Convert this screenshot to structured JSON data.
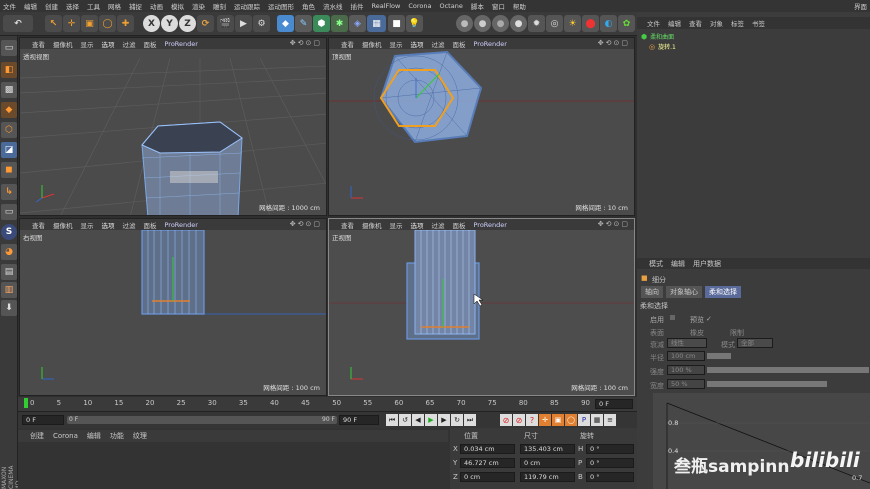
{
  "menubar": {
    "items": [
      "文件",
      "编辑",
      "创建",
      "选择",
      "工具",
      "网格",
      "捕捉",
      "动画",
      "模拟",
      "渲染",
      "雕刻",
      "运动跟踪",
      "运动图形",
      "角色",
      "流水线",
      "插件",
      "RealFlow",
      "Corona",
      "Octane",
      "脚本",
      "窗口",
      "帮助"
    ],
    "right": "界面"
  },
  "viewports": [
    {
      "menu": [
        "查看",
        "摄像机",
        "显示",
        "选项",
        "过滤",
        "面板",
        "ProRender"
      ],
      "label": "透视视图",
      "grid": "网格间距 : 1000 cm"
    },
    {
      "menu": [
        "查看",
        "摄像机",
        "显示",
        "选项",
        "过滤",
        "面板",
        "ProRender"
      ],
      "label": "顶视图",
      "grid": "网格间距 : 10 cm"
    },
    {
      "menu": [
        "查看",
        "摄像机",
        "显示",
        "选项",
        "过滤",
        "面板",
        "ProRender"
      ],
      "label": "右视图",
      "grid": "网格间距 : 100 cm"
    },
    {
      "menu": [
        "查看",
        "摄像机",
        "显示",
        "选项",
        "过滤",
        "面板",
        "ProRender"
      ],
      "label": "正视图",
      "grid": "网格间距 : 100 cm"
    }
  ],
  "object_manager": {
    "tabs": [
      "文件",
      "编辑",
      "查看",
      "对象",
      "标签",
      "书签"
    ],
    "objects": [
      "柔和曲面",
      "旋转.1"
    ]
  },
  "attributes": {
    "tabs": [
      "模式",
      "编辑",
      "用户数据"
    ],
    "title": "细分",
    "subtabs": [
      "轴向",
      "对象轴心",
      "柔和选择"
    ],
    "section": "柔和选择",
    "rows": [
      {
        "label": "启用",
        "value": ""
      },
      {
        "label": "预览",
        "value": "✓"
      },
      {
        "label": "表面",
        "value": ""
      },
      {
        "label": "橡皮",
        "value": ""
      },
      {
        "label": "限制",
        "value": ""
      },
      {
        "label": "衰减",
        "value": "线性"
      },
      {
        "label": "模式",
        "value": "全部"
      },
      {
        "label": "半径",
        "value": "100 cm"
      },
      {
        "label": "强度",
        "value": "100 %"
      },
      {
        "label": "宽度",
        "value": "50 %"
      }
    ],
    "graph_labels": [
      "0.8",
      "0.4",
      "0.7"
    ]
  },
  "timeline": {
    "ticks": [
      "0",
      "5",
      "10",
      "15",
      "20",
      "25",
      "30",
      "35",
      "40",
      "45",
      "50",
      "55",
      "60",
      "65",
      "70",
      "75",
      "80",
      "85",
      "90"
    ],
    "current_frame": "0 F"
  },
  "transport": {
    "start": "0 F",
    "slider_start": "0 F",
    "slider_end": "90 F",
    "end": "90 F"
  },
  "bottom_tabs": [
    "创建",
    "Corona",
    "编辑",
    "功能",
    "纹理"
  ],
  "coords": {
    "headers": [
      "位置",
      "尺寸",
      "旋转"
    ],
    "rows": [
      {
        "axis": "X",
        "pos": "0.034 cm",
        "size": "135.403 cm",
        "rlabel": "H",
        "rot": "0 °"
      },
      {
        "axis": "Y",
        "pos": "46.727 cm",
        "size": "0 cm",
        "rlabel": "P",
        "rot": "0 °"
      },
      {
        "axis": "Z",
        "pos": "0 cm",
        "size": "119.79 cm",
        "rlabel": "B",
        "rot": "0 °"
      }
    ]
  },
  "brand": {
    "side": "MAXON CINEMA 4D",
    "watermark": "叁瓶sampinn",
    "bili": "bilibili"
  }
}
